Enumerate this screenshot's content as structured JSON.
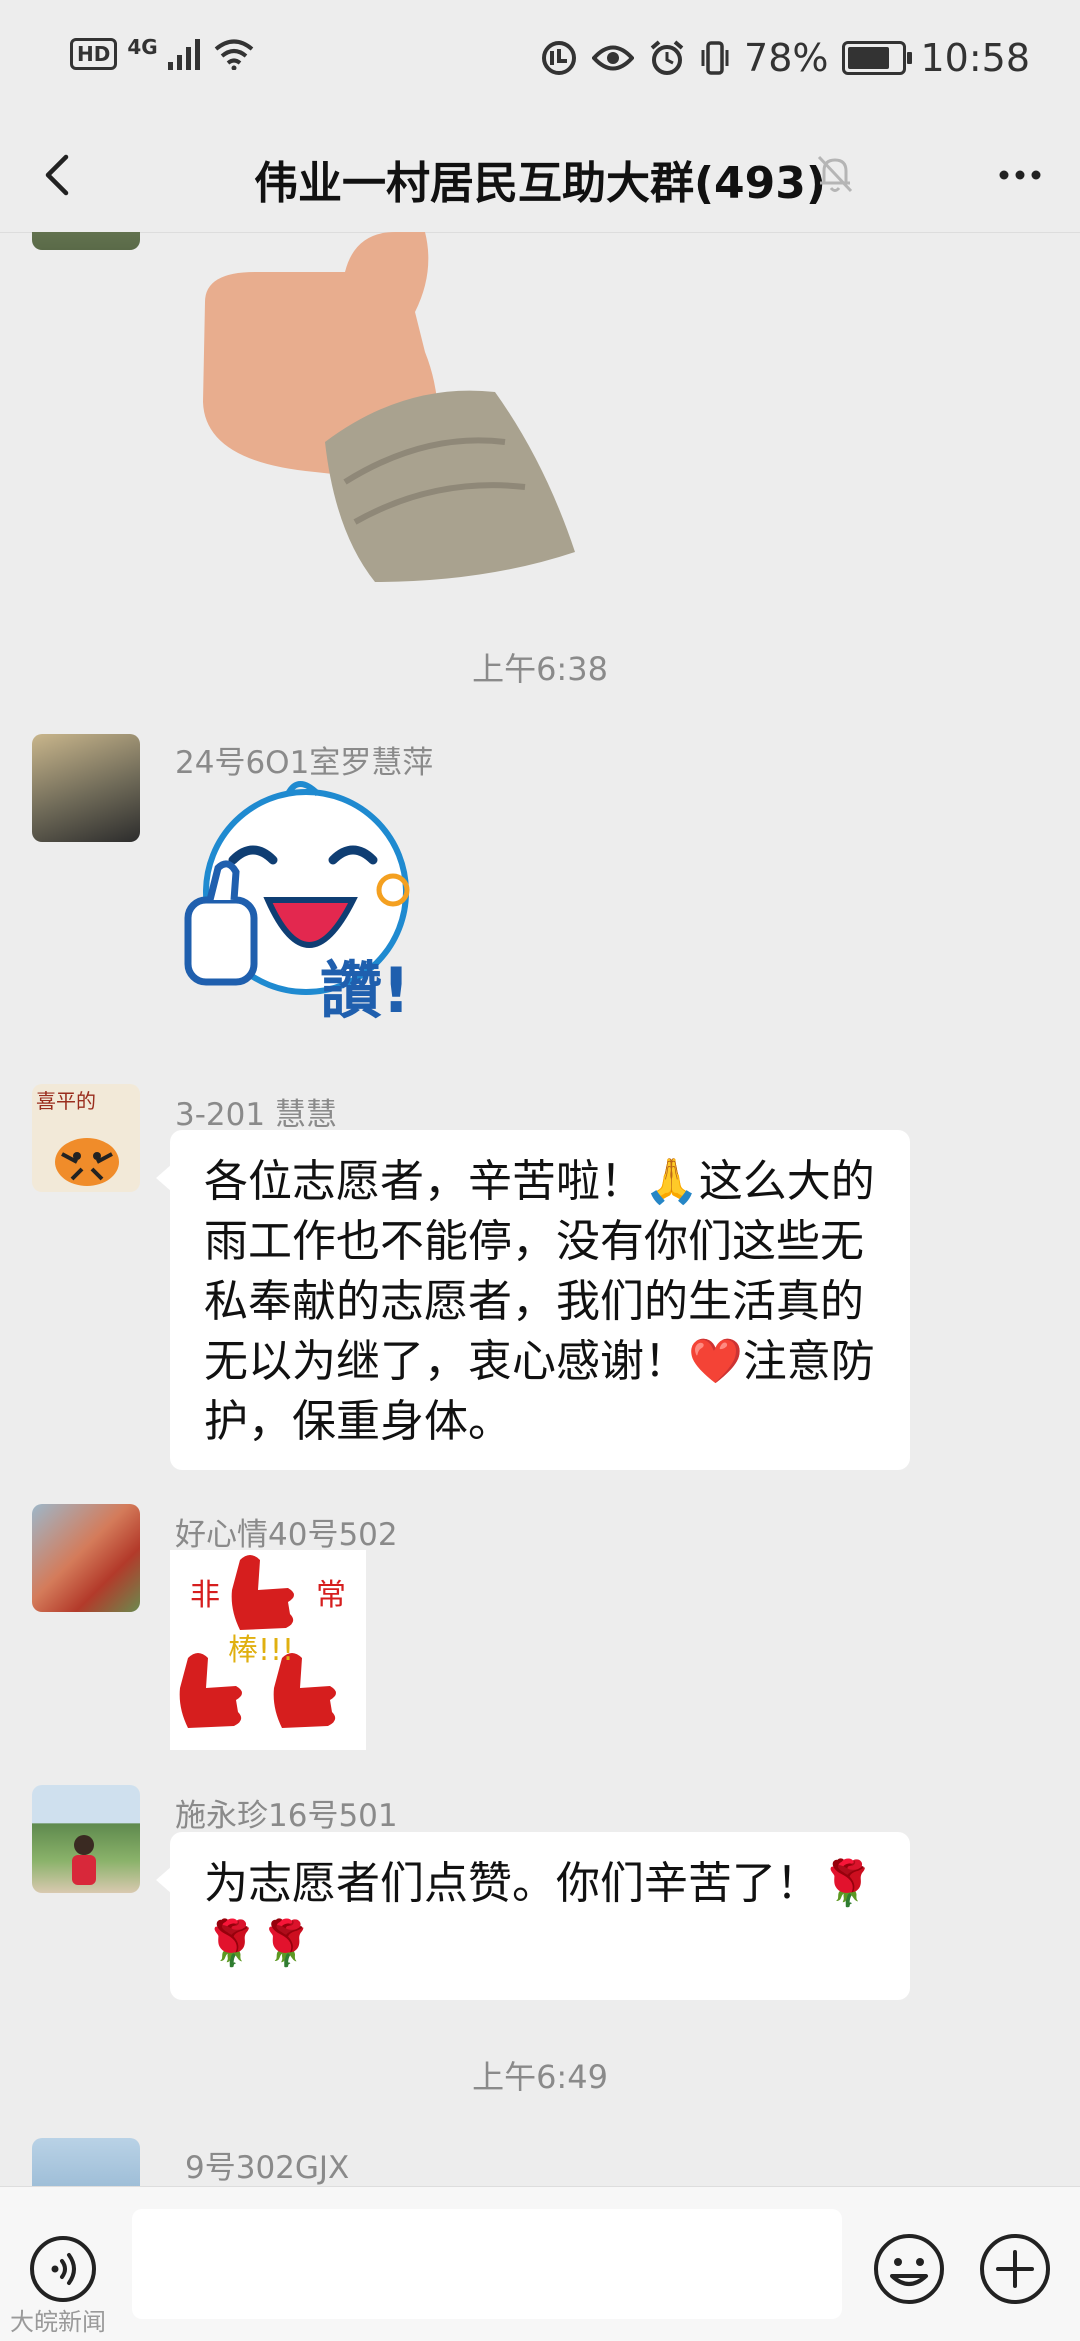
{
  "status_bar": {
    "hd": "HD",
    "network": "4G",
    "battery": "78%",
    "battery_level": 0.78,
    "time": "10:58"
  },
  "header": {
    "title": "伟业一村居民互助大群(493)"
  },
  "messages": [
    {
      "time": "上午6:38"
    },
    {
      "sender": "24号6O1室罗慧萍",
      "sticker_text": "讚!"
    },
    {
      "sender": "3-201 慧慧",
      "text": "各位志愿者，辛苦啦！🙏这么大的雨工作也不能停，没有你们这些无私奉献的志愿者，我们的生活真的无以为继了，衷心感谢！❤️注意防护，保重身体。"
    },
    {
      "sender": "好心情40号502",
      "sticker_texts": [
        "非",
        "常",
        "棒!!!"
      ]
    },
    {
      "sender": "施永珍16号501",
      "text": "为志愿者们点赞。你们辛苦了！🌹🌹🌹"
    },
    {
      "time": "上午6:49"
    },
    {
      "sender": "9号302GJX"
    }
  ],
  "watermark": "大皖新闻",
  "colors": {
    "background": "#ededed",
    "bubble": "#ffffff",
    "sticker_red": "#d61e1e",
    "sticker_blue": "#1f5fae"
  }
}
